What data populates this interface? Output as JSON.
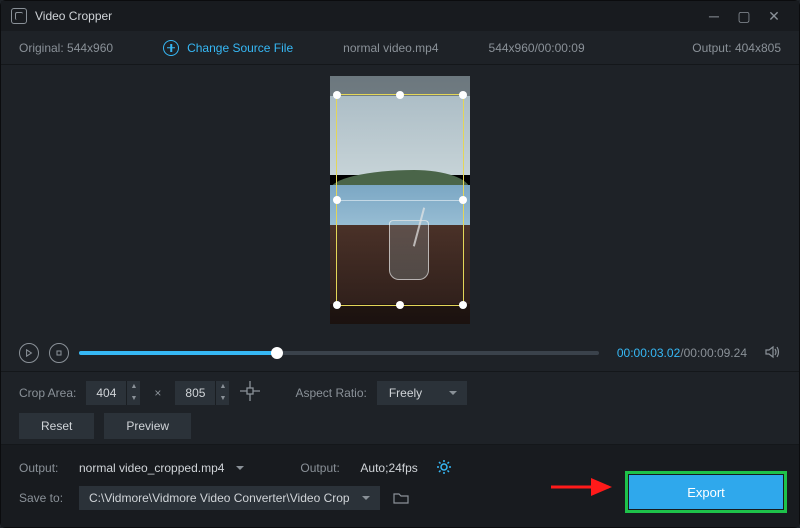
{
  "titlebar": {
    "title": "Video Cropper"
  },
  "infobar": {
    "original_label": "Original:",
    "original_dims": "544x960",
    "change_source": "Change Source File",
    "filename": "normal video.mp4",
    "file_info": "544x960/00:00:09",
    "output_label": "Output:",
    "output_dims": "404x805"
  },
  "player": {
    "current_time": "00:00:03.02",
    "total_time": "00:00:09.24"
  },
  "crop": {
    "area_label": "Crop Area:",
    "width": "404",
    "height": "805",
    "aspect_label": "Aspect Ratio:",
    "aspect_value": "Freely",
    "reset": "Reset",
    "preview": "Preview"
  },
  "output": {
    "output_label1": "Output:",
    "output_filename": "normal video_cropped.mp4",
    "output_label2": "Output:",
    "output_format": "Auto;24fps",
    "saveto_label": "Save to:",
    "saveto_path": "C:\\Vidmore\\Vidmore Video Converter\\Video Crop",
    "export": "Export"
  }
}
